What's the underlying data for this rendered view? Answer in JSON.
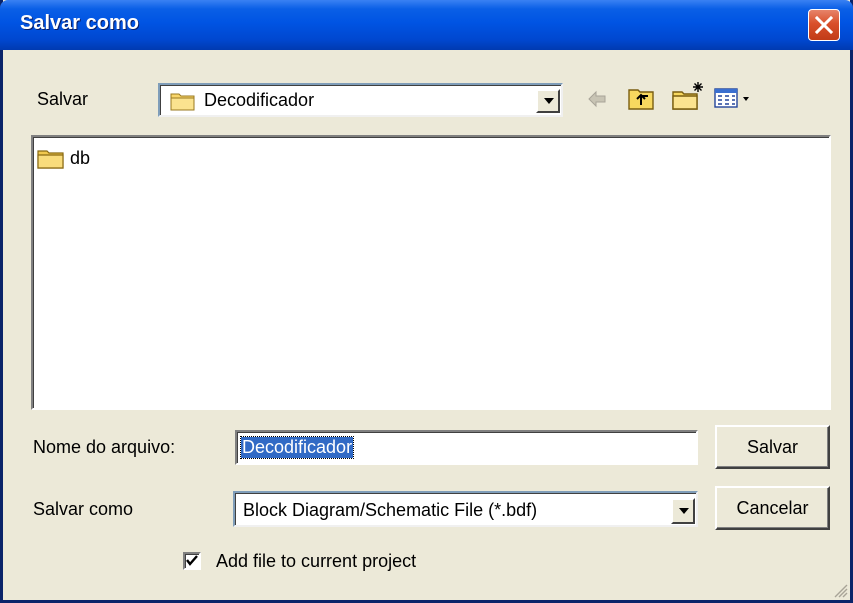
{
  "window": {
    "title": "Salvar como",
    "close_icon": "close-icon"
  },
  "toolbar": {
    "save_in_label": "Salvar",
    "location": "Decodificador",
    "icons": [
      "back-arrow-icon",
      "up-folder-icon",
      "new-folder-icon",
      "view-menu-icon"
    ]
  },
  "file_list": {
    "items": [
      {
        "name": "db",
        "icon": "folder-icon"
      }
    ]
  },
  "filename": {
    "label": "Nome do arquivo:",
    "value": "Decodificador"
  },
  "filetype": {
    "label": "Salvar como",
    "value": "Block Diagram/Schematic File (*.bdf)"
  },
  "buttons": {
    "save": "Salvar",
    "cancel": "Cancelar"
  },
  "options": {
    "add_to_project_label": "Add file to current project",
    "add_to_project_checked": true
  },
  "colors": {
    "title_bar": "#0054e3",
    "selection": "#316ac5",
    "face": "#ece9d8",
    "close": "#d9502b"
  }
}
